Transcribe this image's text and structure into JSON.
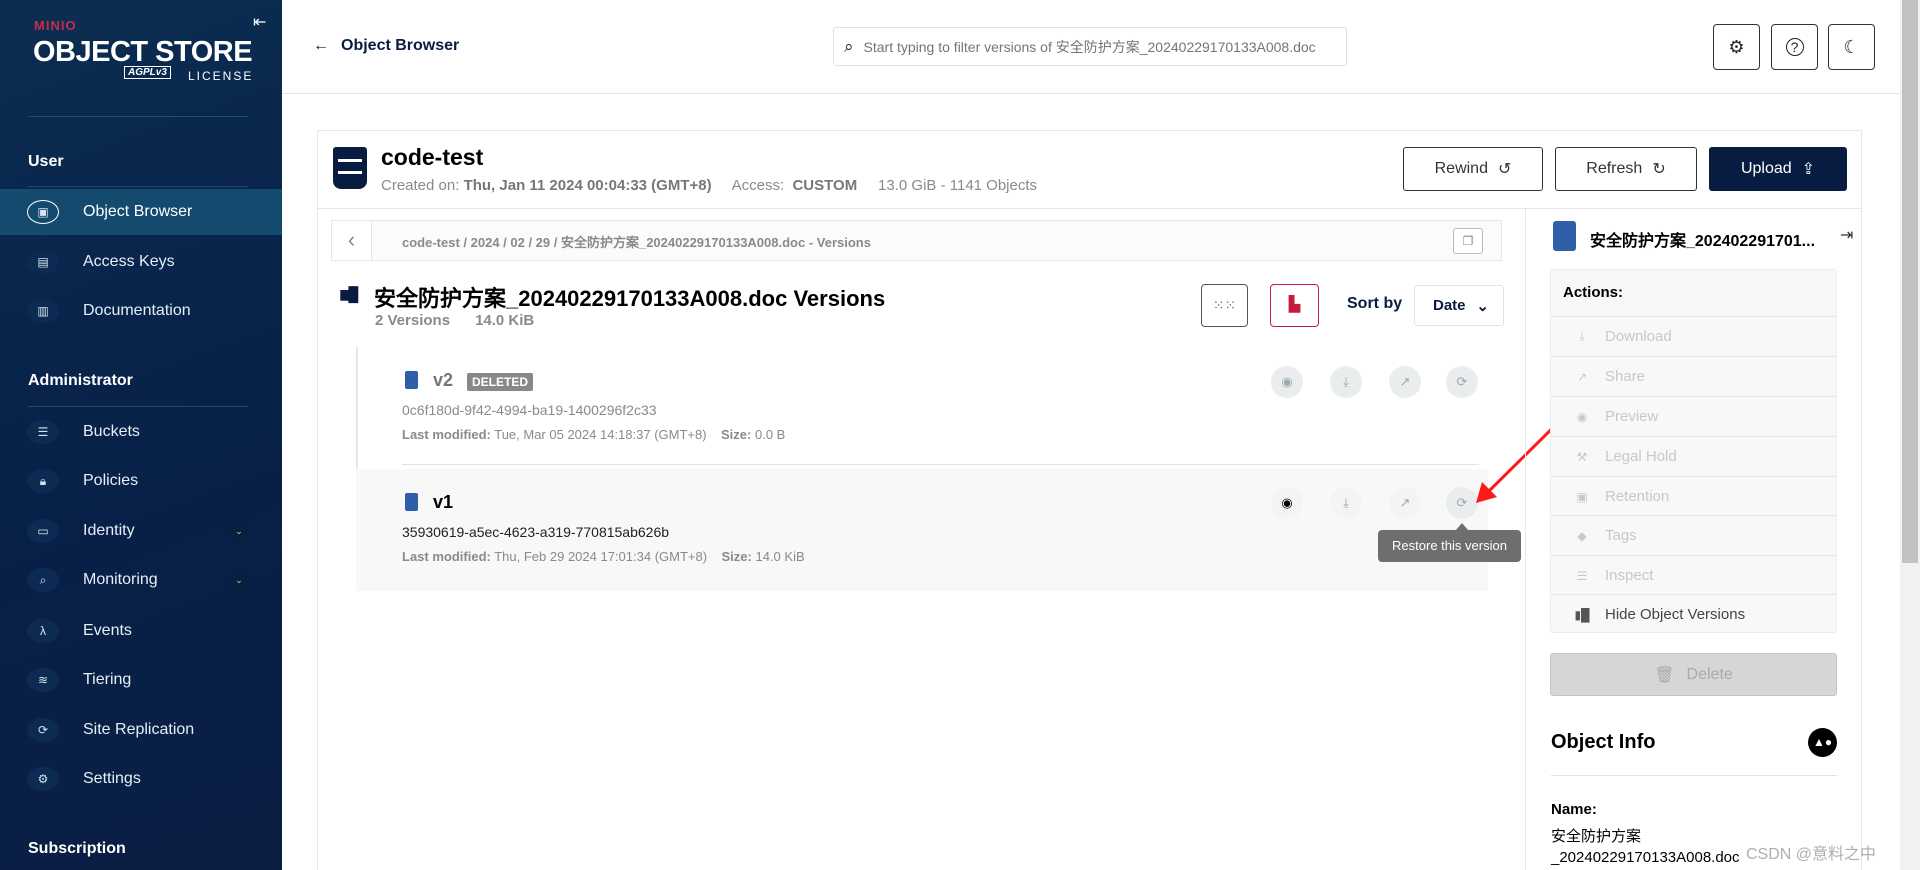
{
  "sidebar": {
    "logo": {
      "brand": "MINIO",
      "product": "OBJECT STORE",
      "license_badge": "AGPLv3",
      "license": "LICENSE"
    },
    "sections": {
      "user": "User",
      "admin": "Administrator",
      "subscription": "Subscription"
    },
    "items": [
      {
        "label": "Object Browser",
        "icon": "object-browser-icon",
        "active": true
      },
      {
        "label": "Access Keys",
        "icon": "access-keys-icon"
      },
      {
        "label": "Documentation",
        "icon": "documentation-icon"
      },
      {
        "label": "Buckets",
        "icon": "buckets-icon"
      },
      {
        "label": "Policies",
        "icon": "policies-icon"
      },
      {
        "label": "Identity",
        "icon": "identity-icon",
        "expandable": true
      },
      {
        "label": "Monitoring",
        "icon": "monitoring-icon",
        "expandable": true
      },
      {
        "label": "Events",
        "icon": "lambda-icon"
      },
      {
        "label": "Tiering",
        "icon": "tiering-icon"
      },
      {
        "label": "Site Replication",
        "icon": "site-replication-icon"
      },
      {
        "label": "Settings",
        "icon": "settings-icon"
      }
    ]
  },
  "header": {
    "back_label": "Object Browser",
    "search_placeholder": "Start typing to filter versions of 安全防护方案_20240229170133A008.doc"
  },
  "bucket": {
    "name": "code-test",
    "created_label": "Created on:",
    "created": "Thu, Jan 11 2024 00:04:33 (GMT+8)",
    "access_label": "Access:",
    "access": "CUSTOM",
    "usage": "13.0 GiB - 1141 Objects",
    "buttons": {
      "rewind": "Rewind",
      "refresh": "Refresh",
      "upload": "Upload"
    }
  },
  "breadcrumb": {
    "path": "code-test / 2024 / 02 / 29 / 安全防护方案_20240229170133A008.doc - Versions"
  },
  "versions": {
    "title": "安全防护方案_20240229170133A008.doc Versions",
    "count": "2 Versions",
    "size": "14.0 KiB",
    "sort_label": "Sort by",
    "sort_value": "Date",
    "items": [
      {
        "name": "v2",
        "badge": "DELETED",
        "id": "0c6f180d-9f42-4994-ba19-1400296f2c33",
        "modified_label": "Last modified:",
        "modified": "Tue, Mar 05 2024 14:18:37 (GMT+8)",
        "size_label": "Size:",
        "size": "0.0 B"
      },
      {
        "name": "v1",
        "id": "35930619-a5ec-4623-a319-770815ab626b",
        "modified_label": "Last modified:",
        "modified": "Thu, Feb 29 2024 17:01:34 (GMT+8)",
        "size_label": "Size:",
        "size": "14.0 KiB"
      }
    ],
    "tooltip": "Restore this version"
  },
  "panel": {
    "file_name": "安全防护方案_202402291701...",
    "actions_label": "Actions:",
    "actions": [
      "Download",
      "Share",
      "Preview",
      "Legal Hold",
      "Retention",
      "Tags",
      "Inspect",
      "Hide Object Versions"
    ],
    "delete": "Delete",
    "info_title": "Object Info",
    "name_label": "Name:",
    "name_line1": "安全防护方案",
    "name_line2": "_20240229170133A008.doc"
  },
  "watermark": "CSDN @意料之中",
  "colors": {
    "sidebar": "#0a2548",
    "accent_dark": "#081c42",
    "danger": "#c51b3c",
    "annotation_arrow": "#ff1a1a"
  }
}
